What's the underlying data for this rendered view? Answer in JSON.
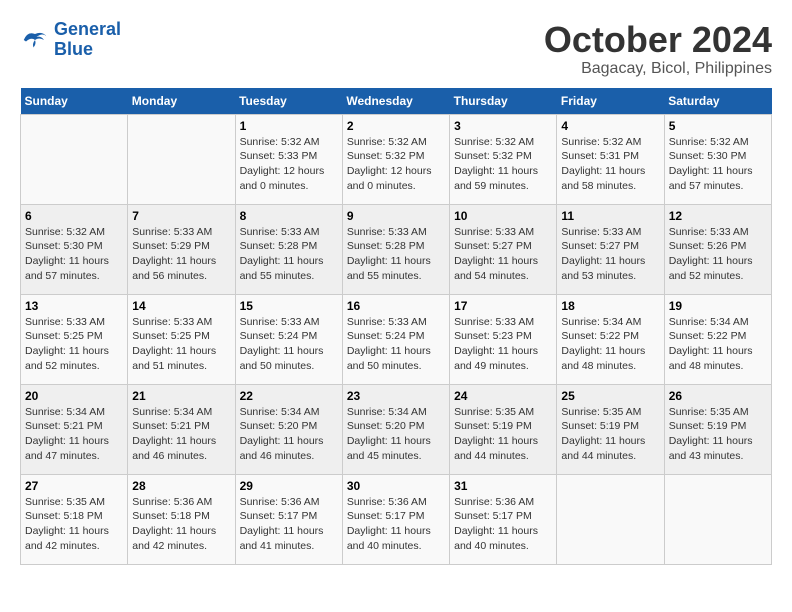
{
  "header": {
    "logo_line1": "General",
    "logo_line2": "Blue",
    "month": "October 2024",
    "location": "Bagacay, Bicol, Philippines"
  },
  "weekdays": [
    "Sunday",
    "Monday",
    "Tuesday",
    "Wednesday",
    "Thursday",
    "Friday",
    "Saturday"
  ],
  "weeks": [
    [
      {
        "day": "",
        "info": ""
      },
      {
        "day": "",
        "info": ""
      },
      {
        "day": "1",
        "info": "Sunrise: 5:32 AM\nSunset: 5:33 PM\nDaylight: 12 hours\nand 0 minutes."
      },
      {
        "day": "2",
        "info": "Sunrise: 5:32 AM\nSunset: 5:32 PM\nDaylight: 12 hours\nand 0 minutes."
      },
      {
        "day": "3",
        "info": "Sunrise: 5:32 AM\nSunset: 5:32 PM\nDaylight: 11 hours\nand 59 minutes."
      },
      {
        "day": "4",
        "info": "Sunrise: 5:32 AM\nSunset: 5:31 PM\nDaylight: 11 hours\nand 58 minutes."
      },
      {
        "day": "5",
        "info": "Sunrise: 5:32 AM\nSunset: 5:30 PM\nDaylight: 11 hours\nand 57 minutes."
      }
    ],
    [
      {
        "day": "6",
        "info": "Sunrise: 5:32 AM\nSunset: 5:30 PM\nDaylight: 11 hours\nand 57 minutes."
      },
      {
        "day": "7",
        "info": "Sunrise: 5:33 AM\nSunset: 5:29 PM\nDaylight: 11 hours\nand 56 minutes."
      },
      {
        "day": "8",
        "info": "Sunrise: 5:33 AM\nSunset: 5:28 PM\nDaylight: 11 hours\nand 55 minutes."
      },
      {
        "day": "9",
        "info": "Sunrise: 5:33 AM\nSunset: 5:28 PM\nDaylight: 11 hours\nand 55 minutes."
      },
      {
        "day": "10",
        "info": "Sunrise: 5:33 AM\nSunset: 5:27 PM\nDaylight: 11 hours\nand 54 minutes."
      },
      {
        "day": "11",
        "info": "Sunrise: 5:33 AM\nSunset: 5:27 PM\nDaylight: 11 hours\nand 53 minutes."
      },
      {
        "day": "12",
        "info": "Sunrise: 5:33 AM\nSunset: 5:26 PM\nDaylight: 11 hours\nand 52 minutes."
      }
    ],
    [
      {
        "day": "13",
        "info": "Sunrise: 5:33 AM\nSunset: 5:25 PM\nDaylight: 11 hours\nand 52 minutes."
      },
      {
        "day": "14",
        "info": "Sunrise: 5:33 AM\nSunset: 5:25 PM\nDaylight: 11 hours\nand 51 minutes."
      },
      {
        "day": "15",
        "info": "Sunrise: 5:33 AM\nSunset: 5:24 PM\nDaylight: 11 hours\nand 50 minutes."
      },
      {
        "day": "16",
        "info": "Sunrise: 5:33 AM\nSunset: 5:24 PM\nDaylight: 11 hours\nand 50 minutes."
      },
      {
        "day": "17",
        "info": "Sunrise: 5:33 AM\nSunset: 5:23 PM\nDaylight: 11 hours\nand 49 minutes."
      },
      {
        "day": "18",
        "info": "Sunrise: 5:34 AM\nSunset: 5:22 PM\nDaylight: 11 hours\nand 48 minutes."
      },
      {
        "day": "19",
        "info": "Sunrise: 5:34 AM\nSunset: 5:22 PM\nDaylight: 11 hours\nand 48 minutes."
      }
    ],
    [
      {
        "day": "20",
        "info": "Sunrise: 5:34 AM\nSunset: 5:21 PM\nDaylight: 11 hours\nand 47 minutes."
      },
      {
        "day": "21",
        "info": "Sunrise: 5:34 AM\nSunset: 5:21 PM\nDaylight: 11 hours\nand 46 minutes."
      },
      {
        "day": "22",
        "info": "Sunrise: 5:34 AM\nSunset: 5:20 PM\nDaylight: 11 hours\nand 46 minutes."
      },
      {
        "day": "23",
        "info": "Sunrise: 5:34 AM\nSunset: 5:20 PM\nDaylight: 11 hours\nand 45 minutes."
      },
      {
        "day": "24",
        "info": "Sunrise: 5:35 AM\nSunset: 5:19 PM\nDaylight: 11 hours\nand 44 minutes."
      },
      {
        "day": "25",
        "info": "Sunrise: 5:35 AM\nSunset: 5:19 PM\nDaylight: 11 hours\nand 44 minutes."
      },
      {
        "day": "26",
        "info": "Sunrise: 5:35 AM\nSunset: 5:19 PM\nDaylight: 11 hours\nand 43 minutes."
      }
    ],
    [
      {
        "day": "27",
        "info": "Sunrise: 5:35 AM\nSunset: 5:18 PM\nDaylight: 11 hours\nand 42 minutes."
      },
      {
        "day": "28",
        "info": "Sunrise: 5:36 AM\nSunset: 5:18 PM\nDaylight: 11 hours\nand 42 minutes."
      },
      {
        "day": "29",
        "info": "Sunrise: 5:36 AM\nSunset: 5:17 PM\nDaylight: 11 hours\nand 41 minutes."
      },
      {
        "day": "30",
        "info": "Sunrise: 5:36 AM\nSunset: 5:17 PM\nDaylight: 11 hours\nand 40 minutes."
      },
      {
        "day": "31",
        "info": "Sunrise: 5:36 AM\nSunset: 5:17 PM\nDaylight: 11 hours\nand 40 minutes."
      },
      {
        "day": "",
        "info": ""
      },
      {
        "day": "",
        "info": ""
      }
    ]
  ]
}
